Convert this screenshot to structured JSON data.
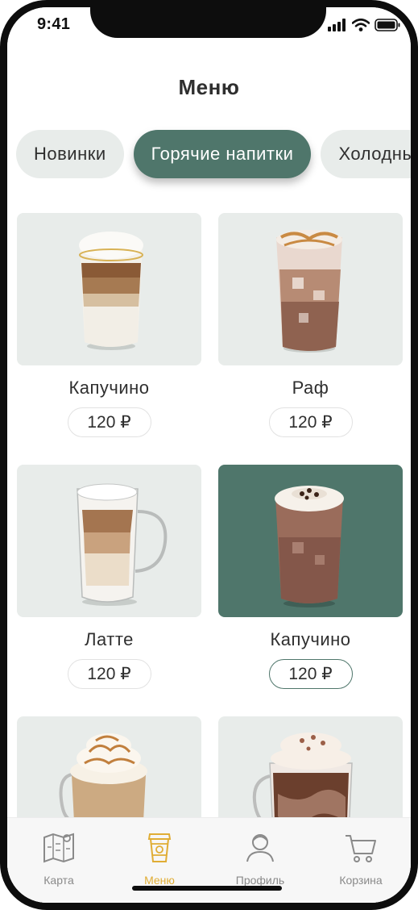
{
  "status_bar": {
    "time": "9:41"
  },
  "header": {
    "title": "Меню"
  },
  "tabs": [
    {
      "label": "Новинки",
      "active": false
    },
    {
      "label": "Горячие напитки",
      "active": true
    },
    {
      "label": "Холодные напитки",
      "active": false
    }
  ],
  "products": [
    {
      "name": "Капучино",
      "price": "120 ₽",
      "image": "layered-cappuccino-glass-image",
      "selected": false
    },
    {
      "name": "Раф",
      "price": "120 ₽",
      "image": "iced-raf-glass-image",
      "selected": false
    },
    {
      "name": "Латте",
      "price": "120 ₽",
      "image": "latte-mug-image",
      "selected": false
    },
    {
      "name": "Капучино",
      "price": "120 ₽",
      "image": "iced-chocolate-glass-image",
      "selected": true
    },
    {
      "name": "",
      "price": "",
      "image": "caramel-whipped-latte-image",
      "selected": false
    },
    {
      "name": "",
      "price": "",
      "image": "mocha-whipped-mug-image",
      "selected": false
    }
  ],
  "tabbar": {
    "items": [
      {
        "label": "Карта",
        "icon": "map-icon",
        "active": false
      },
      {
        "label": "Меню",
        "icon": "cup-icon",
        "active": true
      },
      {
        "label": "Профиль",
        "icon": "profile-icon",
        "active": false
      },
      {
        "label": "Корзина",
        "icon": "cart-icon",
        "active": false
      }
    ]
  },
  "colors": {
    "accent_green": "#4f766b",
    "accent_gold": "#e0ad35",
    "card_bg": "#e8ecea",
    "text_dark": "#2f2f2f",
    "text_muted": "#8a8a8a"
  }
}
